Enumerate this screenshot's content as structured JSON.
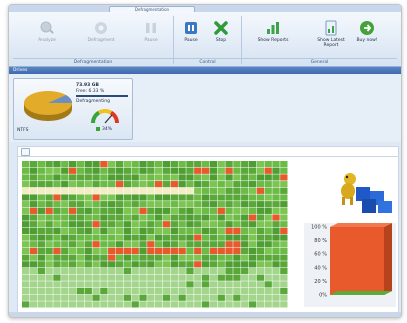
{
  "app": {
    "tabs": [
      "",
      "",
      "Defragmentation",
      "",
      ""
    ],
    "active_tab": 2
  },
  "ribbon": {
    "buttons": [
      {
        "label": "Analyze",
        "icon": "analyze-icon",
        "enabled": false
      },
      {
        "label": "Defragment",
        "icon": "defragment-icon",
        "enabled": false
      },
      {
        "label": "Pause",
        "icon": "pause-icon",
        "enabled": false
      },
      {
        "label": "Pause",
        "icon": "pause-icon",
        "enabled": true
      },
      {
        "label": "Stop",
        "icon": "stop-icon",
        "enabled": true
      },
      {
        "label": "Show Reports",
        "icon": "reports-icon",
        "enabled": true
      },
      {
        "label": "Show Latest Report",
        "icon": "latest-report-icon",
        "enabled": true
      },
      {
        "label": "Buy now!",
        "icon": "buy-now-icon",
        "enabled": true
      }
    ],
    "groups": [
      "Defragmentation",
      "Control",
      "General"
    ]
  },
  "status": {
    "title": "Drives"
  },
  "drive": {
    "label": "NTFS",
    "size": "73.93 GB",
    "free": "Free: 6.33 %",
    "action": "Defragmenting",
    "meter_value": "34%"
  },
  "colors": {
    "accent": "#3e6aaf",
    "fragmented": "#e8592b",
    "contiguous": "#5aa83a",
    "free_space": "#a4d58c",
    "highlight": "#f4ecc4"
  },
  "chart_data": {
    "type": "area",
    "title": "",
    "ylabel": "",
    "y_ticks": [
      "100 %",
      "80 %",
      "60 %",
      "40 %",
      "20 %",
      "0%"
    ],
    "ylim": [
      0,
      100
    ],
    "series": [
      {
        "color": "#e8592b",
        "values": [
          100,
          100,
          100,
          100
        ]
      },
      {
        "color": "#5aa83a",
        "values": [
          0,
          0,
          0,
          0
        ]
      }
    ]
  }
}
